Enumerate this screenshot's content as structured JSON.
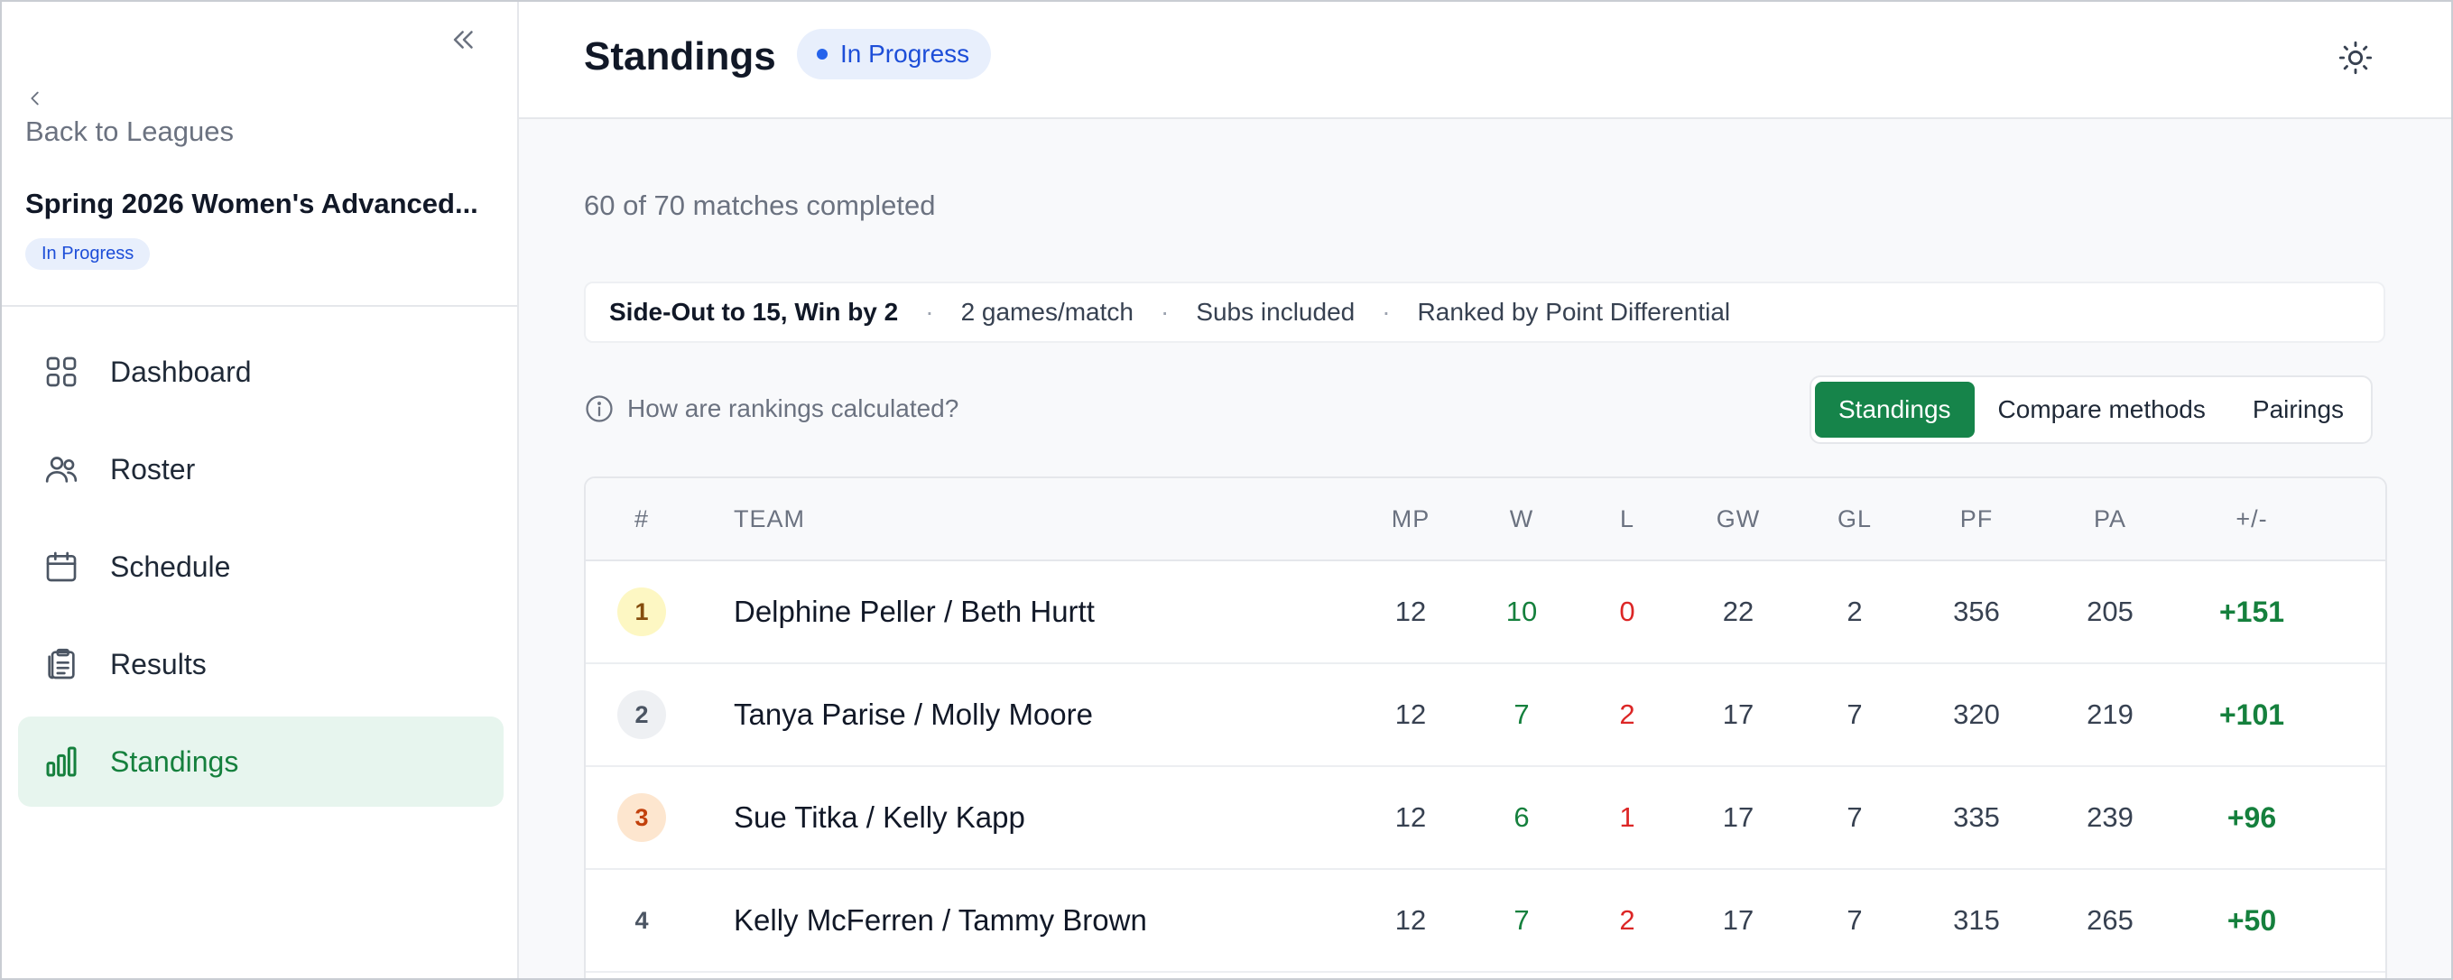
{
  "sidebar": {
    "back_label": "Back to Leagues",
    "league_name": "Spring 2026 Women's Advanced...",
    "league_status": "In Progress",
    "items": [
      {
        "label": "Dashboard",
        "icon": "grid-icon"
      },
      {
        "label": "Roster",
        "icon": "users-icon"
      },
      {
        "label": "Schedule",
        "icon": "calendar-icon"
      },
      {
        "label": "Results",
        "icon": "clipboard-icon"
      },
      {
        "label": "Standings",
        "icon": "bar-chart-icon",
        "active": true
      }
    ]
  },
  "header": {
    "title": "Standings",
    "status": "In Progress"
  },
  "summary": {
    "progress": "60 of 70 matches completed"
  },
  "rules": {
    "format": "Side-Out to 15, Win by 2",
    "games": "2 games/match",
    "subs": "Subs included",
    "ranking": "Ranked by Point Differential",
    "separator": "·"
  },
  "help": {
    "label": "How are rankings calculated?"
  },
  "view_tabs": {
    "standings": "Standings",
    "compare": "Compare methods",
    "pairings": "Pairings"
  },
  "table": {
    "headers": {
      "rank": "#",
      "team": "TEAM",
      "mp": "MP",
      "w": "W",
      "l": "L",
      "gw": "GW",
      "gl": "GL",
      "pf": "PF",
      "pa": "PA",
      "pm": "+/-"
    },
    "rows": [
      {
        "rank": "1",
        "team": "Delphine Peller / Beth Hurtt",
        "mp": "12",
        "w": "10",
        "l": "0",
        "gw": "22",
        "gl": "2",
        "pf": "356",
        "pa": "205",
        "pm": "+151"
      },
      {
        "rank": "2",
        "team": "Tanya Parise / Molly Moore",
        "mp": "12",
        "w": "7",
        "l": "2",
        "gw": "17",
        "gl": "7",
        "pf": "320",
        "pa": "219",
        "pm": "+101"
      },
      {
        "rank": "3",
        "team": "Sue Titka / Kelly Kapp",
        "mp": "12",
        "w": "6",
        "l": "1",
        "gw": "17",
        "gl": "7",
        "pf": "335",
        "pa": "239",
        "pm": "+96"
      },
      {
        "rank": "4",
        "team": "Kelly McFerren / Tammy Brown",
        "mp": "12",
        "w": "7",
        "l": "2",
        "gw": "17",
        "gl": "7",
        "pf": "315",
        "pa": "265",
        "pm": "+50"
      }
    ]
  },
  "colors": {
    "accent_green": "#16844a",
    "win_green": "#15803d",
    "loss_red": "#dc2626",
    "status_blue": "#1d4ed8"
  }
}
